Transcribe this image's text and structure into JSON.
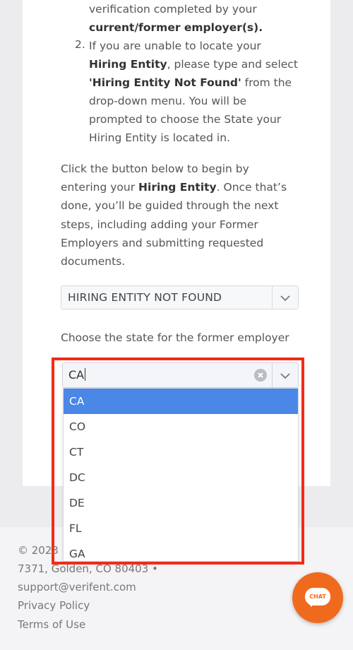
{
  "instructions": {
    "line1": "verification completed by your",
    "line2": "current/former employer(s).",
    "item2_number": "2.",
    "item2_a": "If you are unable to locate your",
    "item2_b": "Hiring Entity",
    "item2_b_rest": ", please type and select",
    "item2_c": "'Hiring Entity Not Found'",
    "item2_c_rest": " from the",
    "item2_d": "drop-down menu. You will be",
    "item2_e": "prompted to choose the State your",
    "item2_f": "Hiring Entity is located in."
  },
  "paragraph": {
    "l1": "Click the button below to begin by",
    "l2_a": "entering your ",
    "l2_b": "Hiring Entity",
    "l2_c": ". Once that’s",
    "l3": "done, you’ll be guided through the next",
    "l4": "steps, including adding your Former",
    "l5": "Employers and submitting requested",
    "l6": "documents."
  },
  "hiring_select": {
    "value": "HIRING ENTITY NOT FOUND"
  },
  "state_label": "Choose the state for the former employer",
  "state_select": {
    "value": "CA"
  },
  "state_options": [
    "CA",
    "CO",
    "CT",
    "DC",
    "DE",
    "FL",
    "GA"
  ],
  "footer": {
    "copyright": "© 2023",
    "address": "7371, Golden, CO 80403 •",
    "email": "support@verifent.com",
    "privacy": "Privacy Policy",
    "terms": "Terms of Use"
  },
  "chat_button": {
    "label": "CHAT"
  },
  "colors": {
    "accent": "#4b87e6",
    "highlight": "#f42a17",
    "chat": "#f06a1e"
  }
}
